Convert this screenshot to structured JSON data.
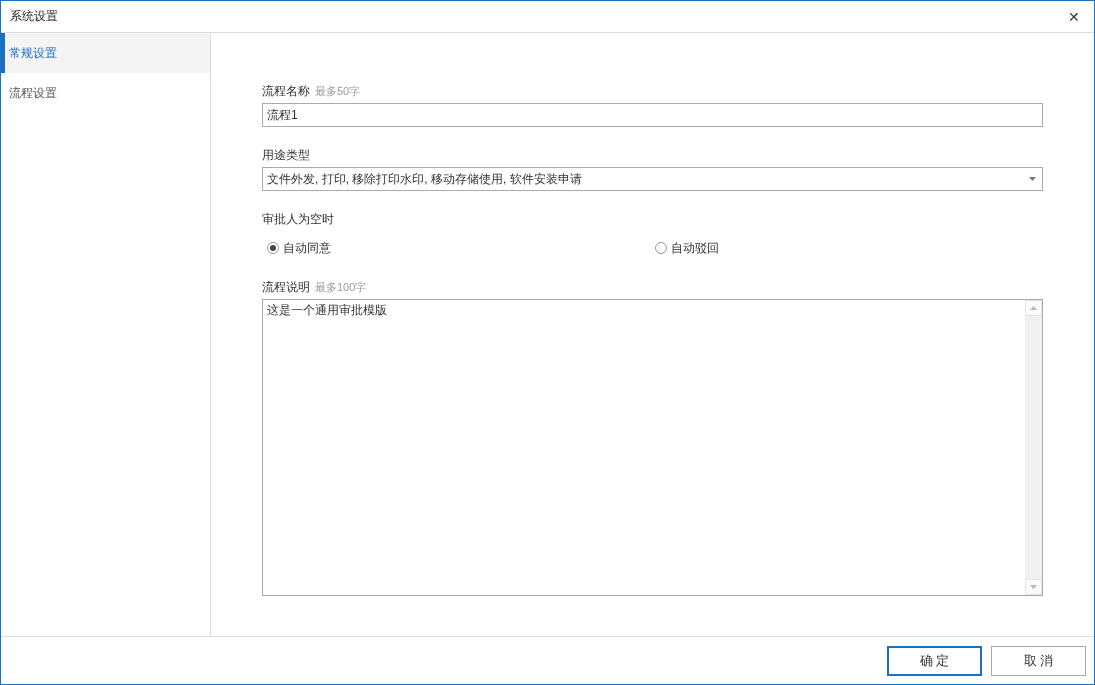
{
  "window": {
    "title": "系统设置",
    "close": "✕"
  },
  "sidebar": {
    "items": [
      {
        "label": "常规设置",
        "selected": true
      },
      {
        "label": "流程设置",
        "selected": false
      }
    ]
  },
  "form": {
    "name": {
      "label": "流程名称",
      "hint": "最多50字",
      "value": "流程1"
    },
    "usage": {
      "label": "用途类型",
      "value": "文件外发, 打印, 移除打印水印, 移动存储使用, 软件安装申请"
    },
    "empty_approver": {
      "label": "审批人为空时",
      "options": [
        {
          "label": "自动同意",
          "selected": true
        },
        {
          "label": "自动驳回",
          "selected": false
        }
      ]
    },
    "description": {
      "label": "流程说明",
      "hint": "最多100字",
      "value": "这是一个通用审批模版"
    }
  },
  "buttons": [
    {
      "label": "确 定",
      "primary": true
    },
    {
      "label": "取 消",
      "primary": false
    }
  ]
}
